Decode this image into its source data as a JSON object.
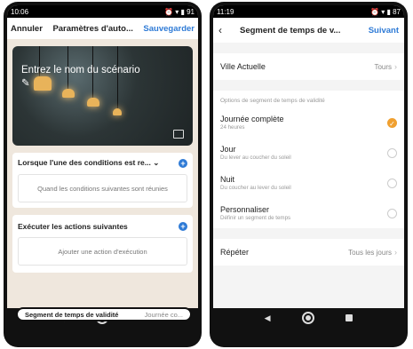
{
  "left": {
    "status": {
      "time": "10:06",
      "carrier": "S",
      "right": "91"
    },
    "header": {
      "cancel": "Annuler",
      "title": "Paramètres d'auto...",
      "save": "Sauvegarder"
    },
    "hero_text": "Entrez le nom du scénario",
    "conditions": {
      "title": "Lorsque l'une des conditions est re...",
      "placeholder": "Quand les conditions suivantes sont réunies"
    },
    "actions": {
      "title": "Exécuter les actions suivantes",
      "placeholder": "Ajouter une action d'exécution"
    },
    "segment": {
      "label": "Segment de temps de validité",
      "value": "Journée co..."
    }
  },
  "right": {
    "status": {
      "time": "11:19",
      "carrier": "S",
      "right": "87"
    },
    "header": {
      "title": "Segment de temps de v...",
      "next": "Suivant"
    },
    "city": {
      "label": "Ville Actuelle",
      "value": "Tours"
    },
    "section_label": "Options de segment de temps de validité",
    "options": [
      {
        "title": "Journée complète",
        "sub": "24 heures",
        "selected": true
      },
      {
        "title": "Jour",
        "sub": "Du lever au coucher du soleil",
        "selected": false
      },
      {
        "title": "Nuit",
        "sub": "Du coucher au lever du soleil",
        "selected": false
      },
      {
        "title": "Personnaliser",
        "sub": "Définir un segment de temps",
        "selected": false
      }
    ],
    "repeat": {
      "label": "Répéter",
      "value": "Tous les jours"
    }
  },
  "colors": {
    "accent": "#2f7bd6",
    "check": "#f0a030"
  }
}
